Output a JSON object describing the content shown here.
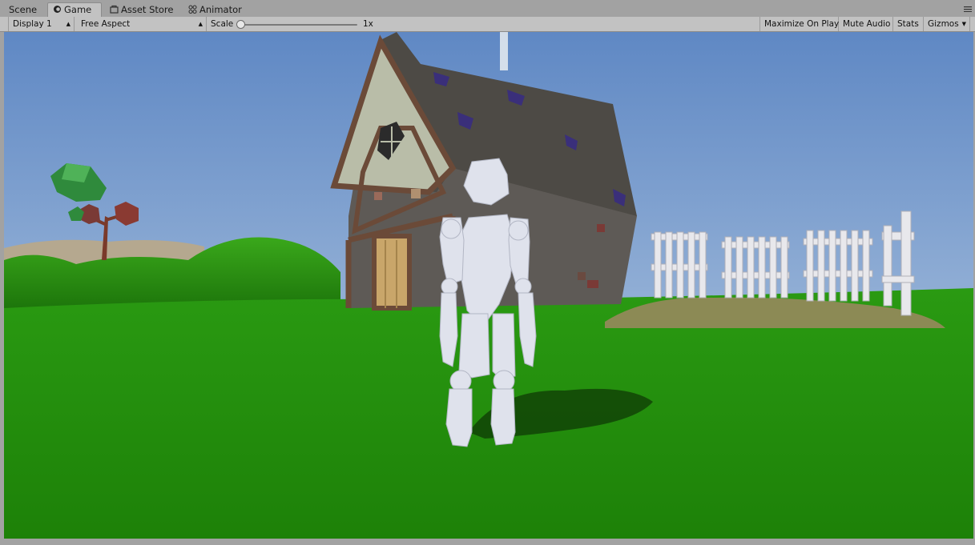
{
  "tabs": [
    {
      "label": "Scene",
      "icon": "scene-icon"
    },
    {
      "label": "Game",
      "icon": "game-icon",
      "active": true
    },
    {
      "label": "Asset Store",
      "icon": "asset-store-icon"
    },
    {
      "label": "Animator",
      "icon": "animator-icon"
    }
  ],
  "toolbar": {
    "display": "Display 1",
    "aspect": "Free Aspect",
    "scale_label": "Scale",
    "scale_value": "1x",
    "maximize": "Maximize On Play",
    "mute": "Mute Audio",
    "stats": "Stats",
    "gizmos": "Gizmos"
  },
  "colors": {
    "sky_top": "#6b8fc6",
    "sky_horizon": "#c9d6e6",
    "grass": "#1f8a0e"
  }
}
